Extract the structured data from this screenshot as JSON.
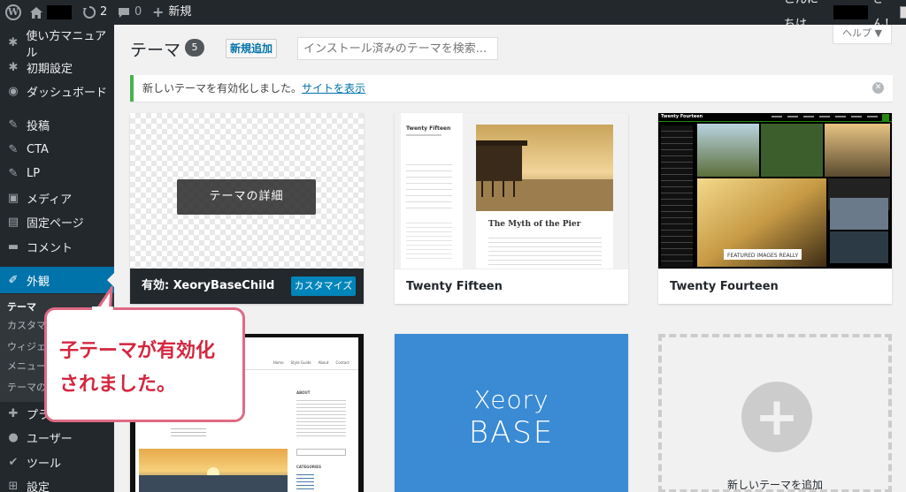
{
  "adminbar": {
    "updates_count": "2",
    "comments_count": "0",
    "new_label": "新規",
    "greeting_prefix": "こんにちは、",
    "greeting_suffix": "さん！"
  },
  "sidebar": {
    "items": [
      {
        "label": "使い方マニュアル",
        "icon": "gear-icon"
      },
      {
        "label": "初期設定",
        "icon": "gear-icon"
      },
      {
        "label": "ダッシュボード",
        "icon": "dashboard-icon"
      },
      {
        "label": "投稿",
        "icon": "pin-icon"
      },
      {
        "label": "CTA",
        "icon": "pin-icon"
      },
      {
        "label": "LP",
        "icon": "pin-icon"
      },
      {
        "label": "メディア",
        "icon": "media-icon"
      },
      {
        "label": "固定ページ",
        "icon": "page-icon"
      },
      {
        "label": "コメント",
        "icon": "comment-icon"
      },
      {
        "label": "外観",
        "icon": "brush-icon"
      },
      {
        "label": "プラグ",
        "icon": "plugin-icon"
      },
      {
        "label": "ユーザー",
        "icon": "user-icon"
      },
      {
        "label": "ツール",
        "icon": "wrench-icon"
      },
      {
        "label": "設定",
        "icon": "settings-icon"
      }
    ],
    "submenu": [
      "テーマ",
      "カスタマイ",
      "ウィジェ",
      "メニュー",
      "テーマの"
    ]
  },
  "header": {
    "title": "テーマ",
    "count": "5",
    "add_new": "新規追加",
    "search_placeholder": "インストール済みのテーマを検索...",
    "help": "ヘルプ ▼"
  },
  "notice": {
    "text": "新しいテーマを有効化しました。",
    "link": "サイトを表示"
  },
  "themes": {
    "active": {
      "prefix": "有効: ",
      "name": "XeoryBaseChild",
      "details": "テーマの詳細",
      "customize": "カスタマイズ"
    },
    "fifteen": {
      "name": "Twenty Fifteen",
      "post_title": "The Myth of the Pier",
      "site_title": "Twenty Fifteen"
    },
    "fourteen": {
      "name": "Twenty Fourteen",
      "site_title": "Twenty Fourteen",
      "featured": "FEATURED IMAGES REALLY"
    },
    "twelve": {
      "nav": [
        "Home",
        "Style Guide",
        "About",
        "Contact"
      ],
      "sidebar_heading": "ABOUT",
      "categories_heading": "CATEGORIES"
    },
    "xeory": {
      "line1": "Xeory",
      "line2": "BASE"
    },
    "add_new": "新しいテーマを追加"
  },
  "callout": {
    "line1": "子テーマが有効化",
    "line2": "されました。"
  },
  "colors": {
    "sidebar_bg": "#23282d",
    "accent": "#0073aa",
    "notice_border": "#46b450",
    "callout_border": "#e06a85",
    "callout_text": "#d3273e",
    "xeory_bg": "#3a8ad4"
  }
}
